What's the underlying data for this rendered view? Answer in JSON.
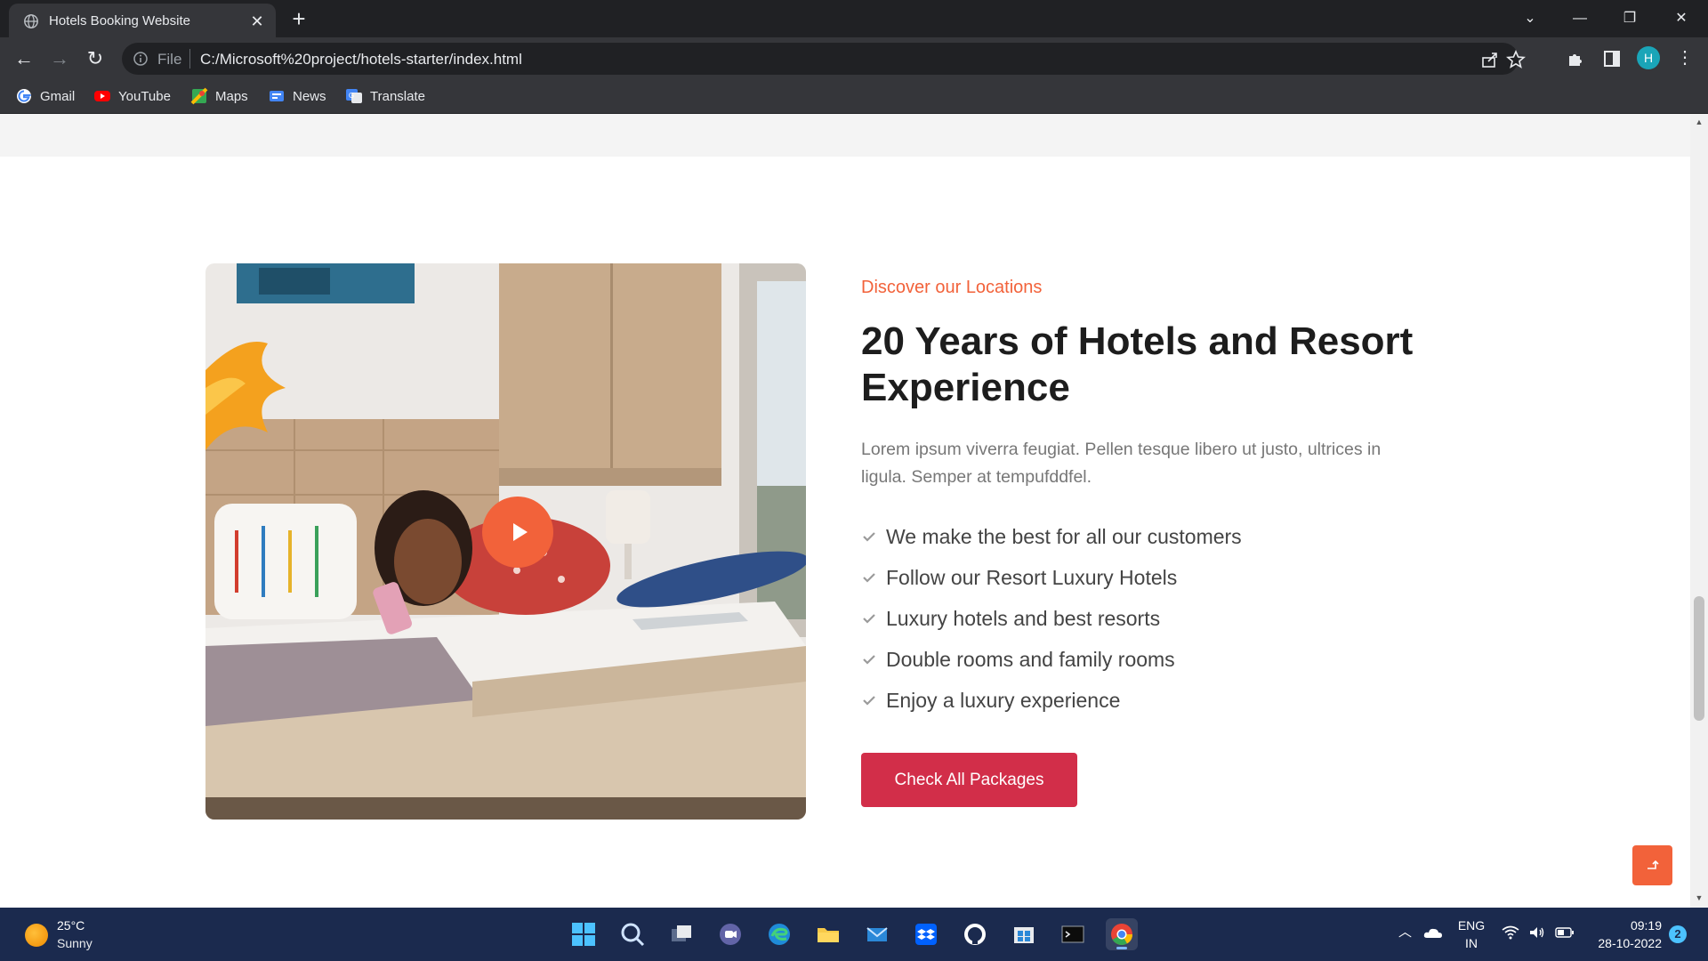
{
  "browser": {
    "tab_title": "Hotels Booking Website",
    "omnibox_scheme": "File",
    "url": "C:/Microsoft%20project/hotels-starter/index.html",
    "profile_initial": "H",
    "bookmarks": [
      {
        "label": "Gmail",
        "icon": "gmail-icon"
      },
      {
        "label": "YouTube",
        "icon": "youtube-icon"
      },
      {
        "label": "Maps",
        "icon": "maps-icon"
      },
      {
        "label": "News",
        "icon": "news-icon"
      },
      {
        "label": "Translate",
        "icon": "translate-icon"
      }
    ]
  },
  "section": {
    "eyebrow": "Discover our Locations",
    "headline": "20 Years of Hotels and Resort Experience",
    "lead": "Lorem ipsum viverra feugiat. Pellen tesque libero ut justo, ultrices in ligula. Semper at tempufddfel.",
    "features": [
      "We make the best for all our customers",
      "Follow our Resort Luxury Hotels",
      "Luxury hotels and best resorts",
      "Double rooms and family rooms",
      "Enjoy a luxury experience"
    ],
    "cta_label": "Check All Packages"
  },
  "colors": {
    "accent_orange": "#f2623a",
    "cta_red": "#d22e49",
    "heading": "#1d1d1d",
    "body_text": "#777777"
  },
  "taskbar": {
    "weather_temp": "25°C",
    "weather_desc": "Sunny",
    "lang_line1": "ENG",
    "lang_line2": "IN",
    "time": "09:19",
    "date": "28-10-2022",
    "notifications": "2"
  }
}
